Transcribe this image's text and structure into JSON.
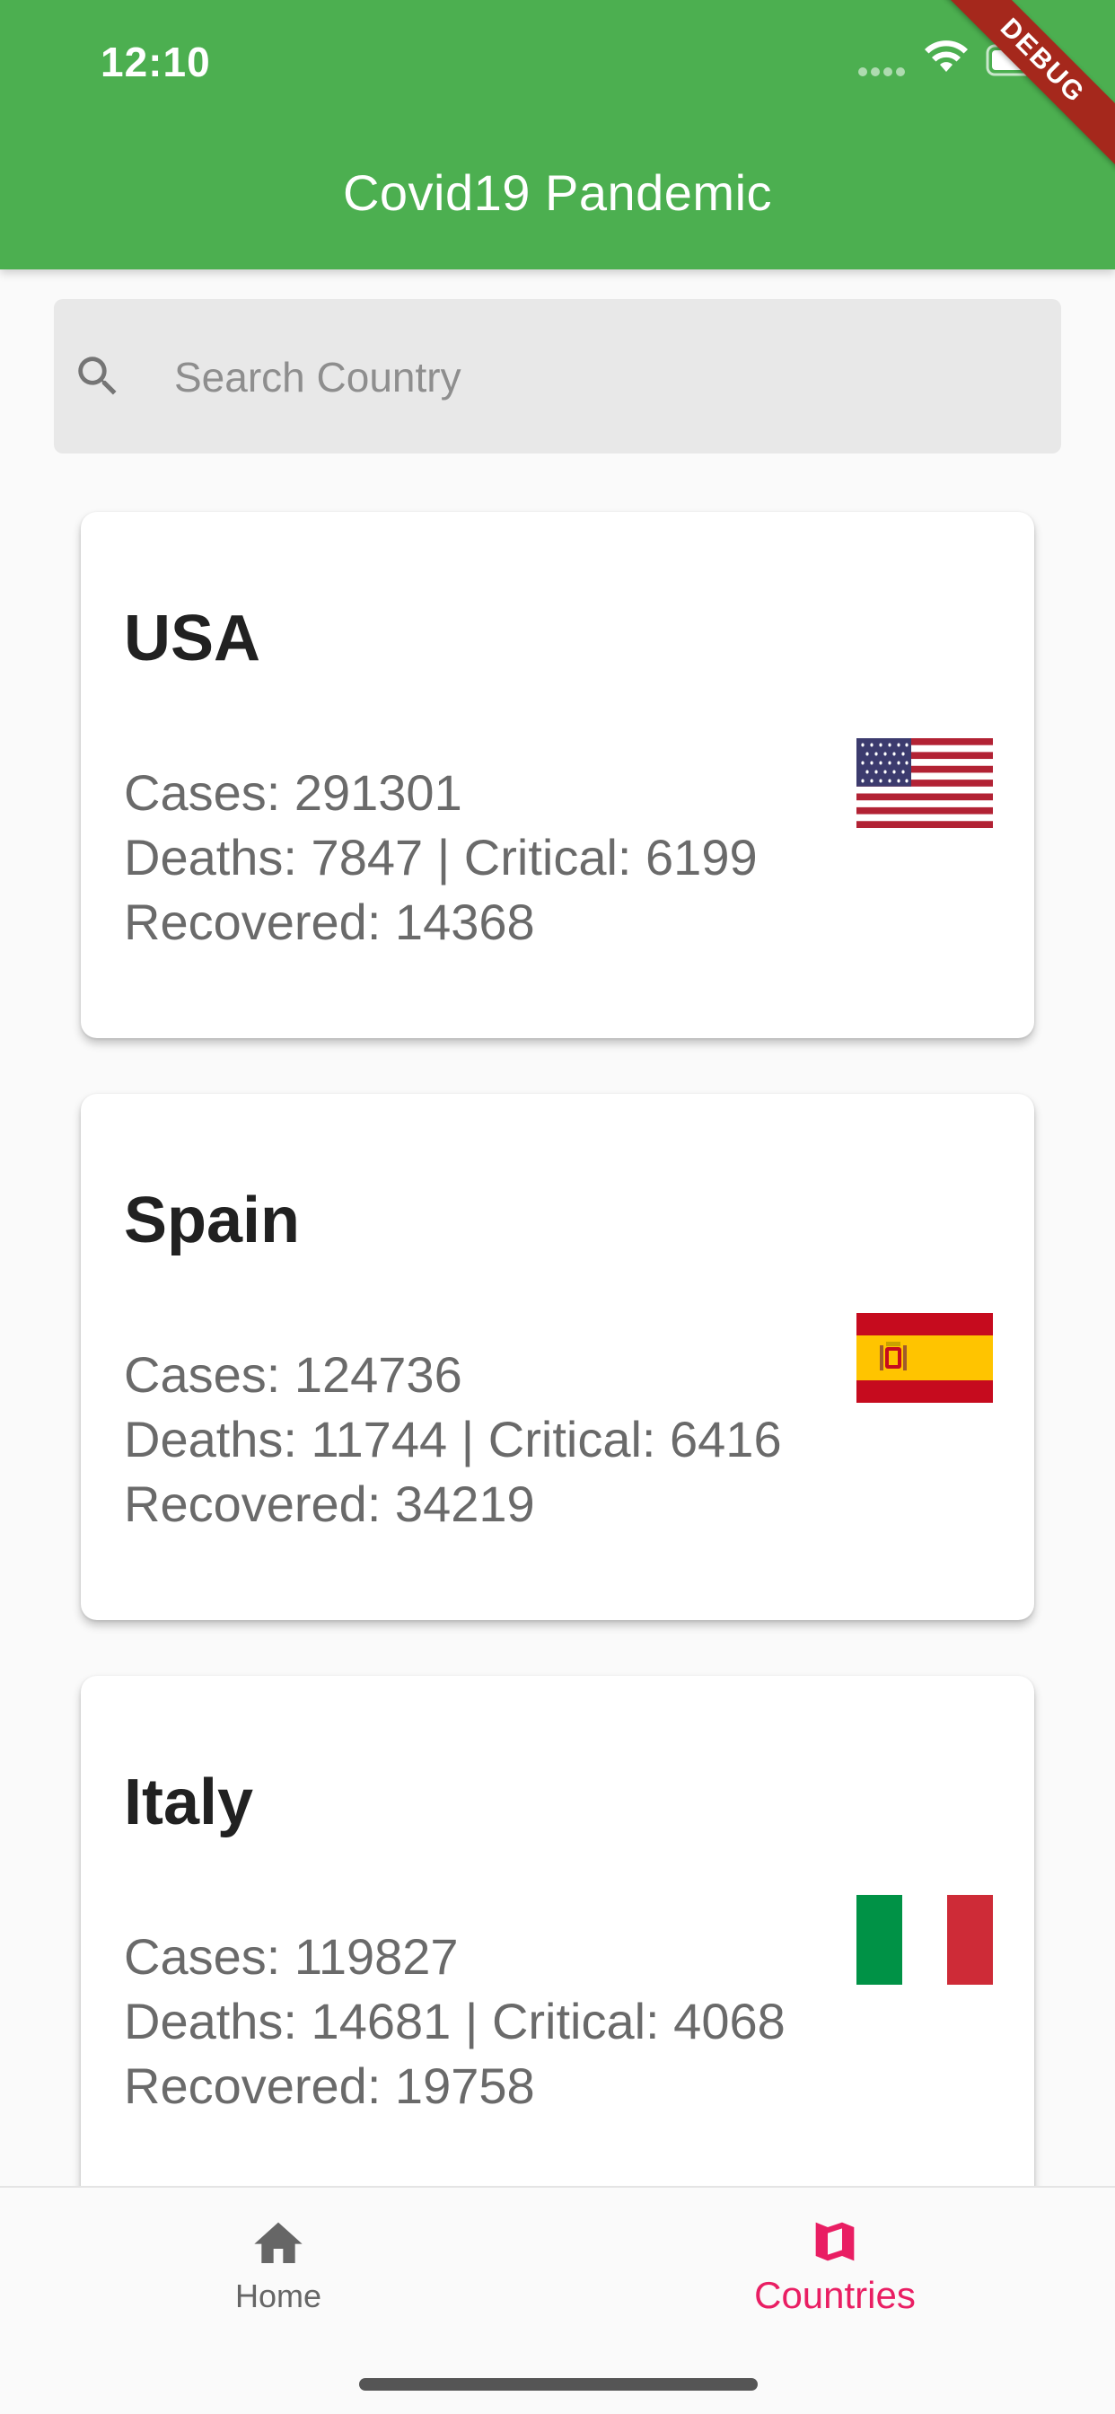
{
  "status_bar": {
    "time": "12:10"
  },
  "app_bar": {
    "title": "Covid19 Pandemic",
    "debug_label": "DEBUG"
  },
  "search": {
    "placeholder": "Search Country"
  },
  "countries": [
    {
      "name": "USA",
      "cases": "Cases: 291301",
      "deaths_critical": "Deaths: 7847 | Critical: 6199",
      "recovered": "Recovered: 14368",
      "flag_icon": "usa-flag-icon"
    },
    {
      "name": "Spain",
      "cases": "Cases: 124736",
      "deaths_critical": "Deaths: 11744 | Critical: 6416",
      "recovered": "Recovered: 34219",
      "flag_icon": "spain-flag-icon"
    },
    {
      "name": "Italy",
      "cases": "Cases: 119827",
      "deaths_critical": "Deaths: 14681 | Critical: 4068",
      "recovered": "Recovered: 19758",
      "flag_icon": "italy-flag-icon"
    }
  ],
  "bottom_nav": {
    "items": [
      {
        "label": "Home",
        "icon": "home-icon",
        "active": false
      },
      {
        "label": "Countries",
        "icon": "map-icon",
        "active": true
      }
    ]
  },
  "colors": {
    "app_bar": "#4caf50",
    "active_nav": "#e91e63",
    "inactive_nav": "#666666",
    "debug_banner": "#a5281c"
  }
}
